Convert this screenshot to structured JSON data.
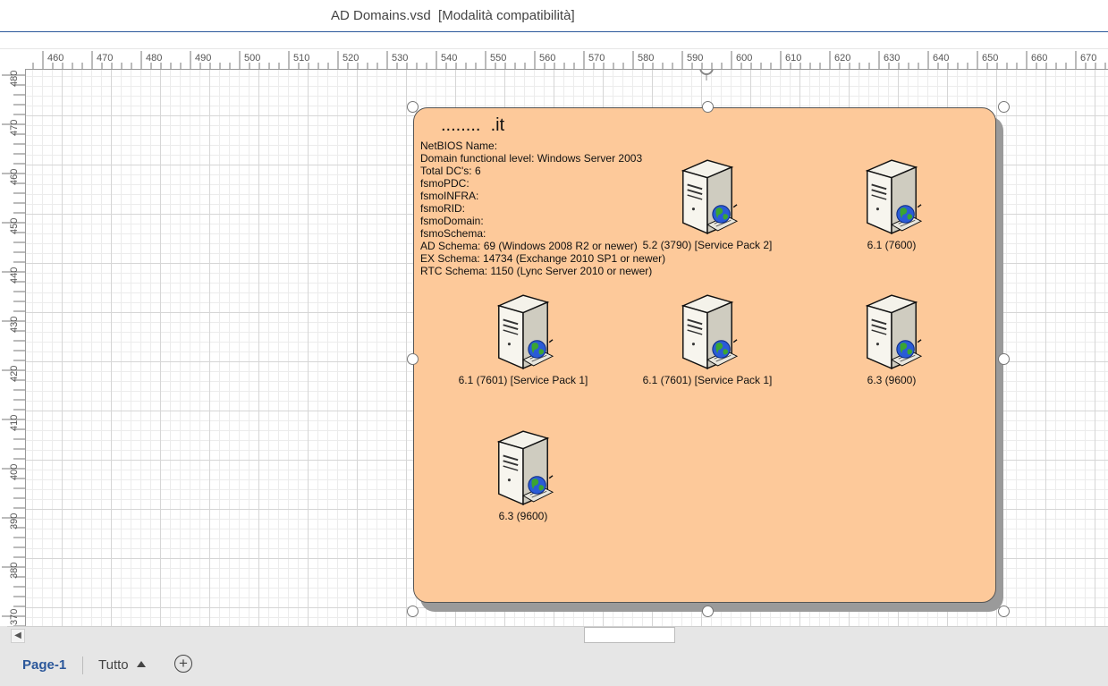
{
  "window": {
    "title": "AD Domains.vsd  [Modalità compatibilità]"
  },
  "ruler": {
    "horizontal": [
      "460",
      "470",
      "480",
      "490",
      "500",
      "510",
      "520",
      "530",
      "540",
      "550",
      "560",
      "570",
      "580",
      "590",
      "600",
      "610",
      "620",
      "630",
      "640",
      "650",
      "660",
      "670"
    ],
    "vertical": [
      "480",
      "470",
      "460",
      "450",
      "440",
      "430",
      "420",
      "410",
      "400",
      "390",
      "380",
      "370"
    ]
  },
  "diagram": {
    "domain_title": "........  .it",
    "info_lines": [
      "NetBIOS Name:",
      "Domain functional level: Windows Server 2003",
      "Total DC's: 6",
      "fsmoPDC:",
      "fsmoINFRA:",
      "fsmoRID:",
      "fsmoDomain:",
      "fsmoSchema:",
      "AD Schema: 69 (Windows 2008 R2 or newer)",
      "EX Schema: 14734 (Exchange 2010 SP1 or newer)",
      "RTC Schema: 1150 (Lync Server 2010 or newer)"
    ],
    "servers": [
      {
        "label": "5.2 (3790) [Service Pack 2]",
        "icon": "server-globe-icon"
      },
      {
        "label": "6.1 (7600)",
        "icon": "server-globe-icon"
      },
      {
        "label": "6.1 (7601) [Service Pack 1]",
        "icon": "server-globe-icon"
      },
      {
        "label": "6.1 (7601) [Service Pack 1]",
        "icon": "server-globe-icon"
      },
      {
        "label": "6.3 (9600)",
        "icon": "server-globe-icon"
      },
      {
        "label": "6.3 (9600)",
        "icon": "server-globe-icon"
      }
    ]
  },
  "tabs": {
    "active": "Page-1",
    "all": "Tutto",
    "add_icon": "plus-circle-icon"
  },
  "colors": {
    "container_fill": "#fdc99a",
    "accent": "#2b579a"
  }
}
